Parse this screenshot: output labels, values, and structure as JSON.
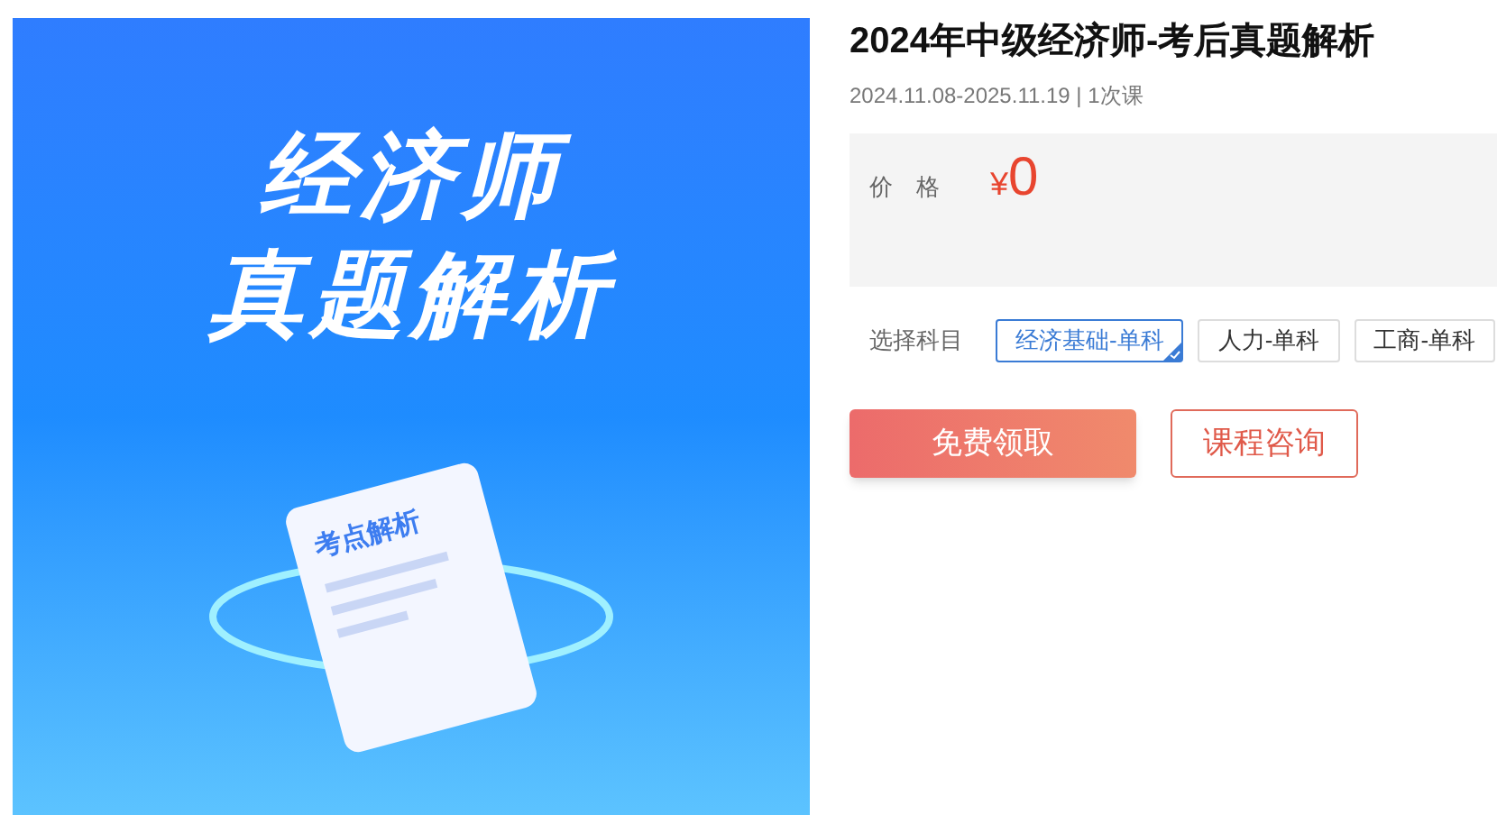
{
  "cover": {
    "title_lines": [
      "经济师",
      "真题解析"
    ],
    "paper_label": "考点解析"
  },
  "course": {
    "title": "2024年中级经济师-考后真题解析",
    "meta": "2024.11.08-2025.11.19 | 1次课"
  },
  "price": {
    "label": "价　格",
    "currency": "¥",
    "amount": "0"
  },
  "subjects": {
    "label": "选择科目",
    "options": [
      {
        "label": "经济基础-单科",
        "selected": true
      },
      {
        "label": "人力-单科",
        "selected": false
      },
      {
        "label": "工商-单科",
        "selected": false
      }
    ]
  },
  "actions": [
    {
      "label": "免费领取",
      "kind": "primary"
    },
    {
      "label": "课程咨询",
      "kind": "outline"
    }
  ]
}
